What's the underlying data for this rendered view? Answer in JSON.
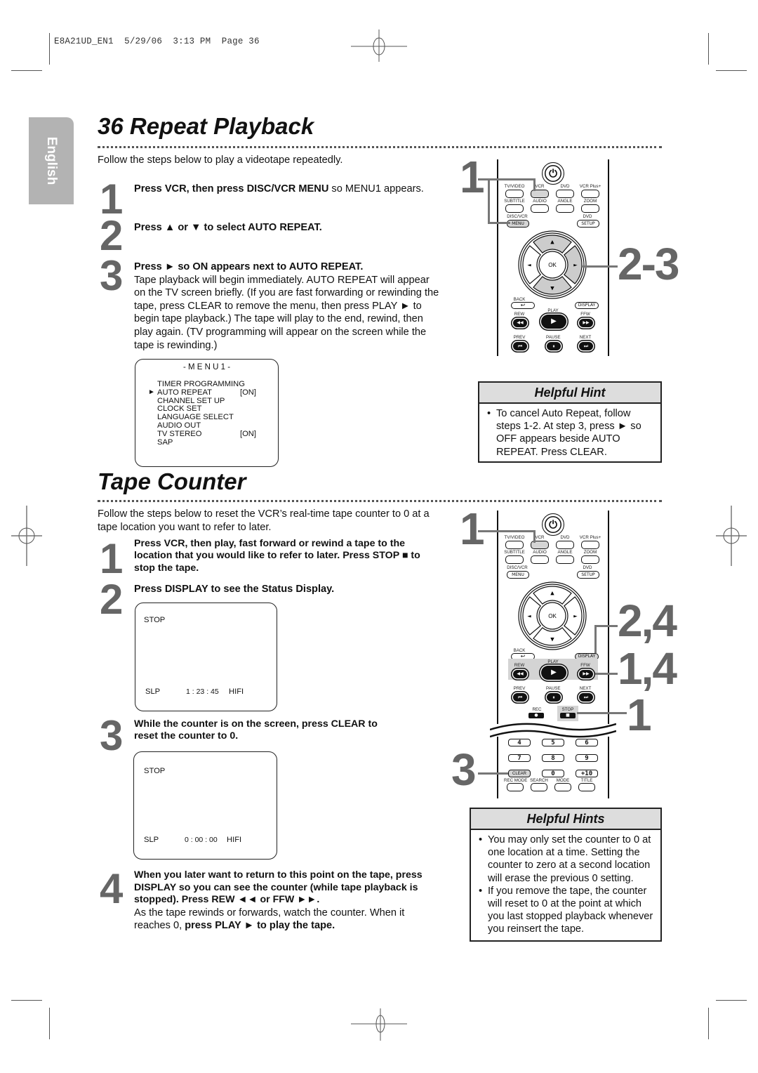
{
  "slug": "E8A21UD_EN1  5/29/06  3:13 PM  Page 36",
  "language_tab": "English",
  "repeat": {
    "title": "36  Repeat Playback",
    "intro": "Follow the steps below to play a videotape repeatedly.",
    "steps": [
      {
        "num": "1",
        "bold": "Press VCR, then press DISC/VCR MENU",
        "text": " so MENU1 appears."
      },
      {
        "num": "2",
        "bold": "Press ▲ or ▼ to select AUTO REPEAT.",
        "text": ""
      },
      {
        "num": "3",
        "bold": "Press ► so ON appears next to AUTO REPEAT.",
        "text": "Tape playback will begin immediately. AUTO REPEAT will appear on the TV screen briefly. (If you are fast forwarding or rewinding the tape, press CLEAR to remove the menu, then press PLAY ► to begin tape playback.) The tape will play to the end, rewind, then play again. (TV programming will appear on the screen while the tape is rewinding.)"
      }
    ],
    "menu": {
      "title": "- M E N U 1 -",
      "cursor": "►",
      "items": [
        {
          "label": "TIMER PROGRAMMING",
          "value": ""
        },
        {
          "label": "AUTO REPEAT",
          "value": "[ON]"
        },
        {
          "label": "CHANNEL SET UP",
          "value": ""
        },
        {
          "label": "CLOCK SET",
          "value": ""
        },
        {
          "label": "LANGUAGE SELECT",
          "value": ""
        },
        {
          "label": "AUDIO OUT",
          "value": ""
        },
        {
          "label": "TV STEREO",
          "value": "[ON]"
        },
        {
          "label": "SAP",
          "value": ""
        }
      ]
    },
    "hint": {
      "title": "Helpful Hint",
      "items": [
        "To cancel Auto Repeat, follow steps 1-2. At step 3, press ► so OFF appears beside AUTO REPEAT. Press CLEAR."
      ]
    },
    "callouts": [
      "1",
      "2-3"
    ]
  },
  "counter": {
    "title": "Tape Counter",
    "intro": "Follow the steps below to reset the VCR’s real-time tape counter to 0 at a tape location you want to refer to later.",
    "steps": [
      {
        "num": "1",
        "bold": "Press VCR, then play, fast forward or rewind a tape to the location that you would like to refer to later. Press STOP ■ to stop the tape.",
        "text": ""
      },
      {
        "num": "2",
        "bold": "Press DISPLAY to see the Status Display.",
        "text": ""
      },
      {
        "num": "3",
        "bold": "While the counter is on the screen, press CLEAR to reset the counter to 0.",
        "text": ""
      },
      {
        "num": "4",
        "bold": "When you later want to return to this point on the tape, press DISPLAY so you can see the counter (while tape playback is stopped). Press REW ◄◄ or FFW ►►.",
        "text": "As the tape rewinds or forwards, watch the counter. When it reaches 0, ",
        "bold2": "press PLAY ► to play the tape."
      }
    ],
    "screen1": {
      "status": "STOP",
      "mode": "SLP",
      "time": "1 : 23 : 45",
      "audio": "HIFI"
    },
    "screen2": {
      "status": "STOP",
      "mode": "SLP",
      "time": "0 : 00 : 00",
      "audio": "HIFI"
    },
    "hint": {
      "title": "Helpful Hints",
      "items": [
        "You may only set the counter to 0 at one location at a time. Setting the counter to zero at a second location will erase the previous 0 setting.",
        "If you remove the tape, the counter will reset to 0 at the point at which you last stopped playback whenever you reinsert the tape."
      ]
    },
    "callouts": [
      "1",
      "2,4",
      "1,4",
      "1",
      "3"
    ]
  },
  "remote": {
    "row1": [
      "TV/VIDEO",
      "VCR",
      "DVD",
      "VCR Plus+"
    ],
    "row2": [
      "SUBTITLE",
      "AUDIO",
      "ANGLE",
      "ZOOM"
    ],
    "menu_top": "DISC/VCR",
    "menu_btn": "MENU",
    "setup_top": "DVD",
    "setup_btn": "SETUP",
    "ok": "OK",
    "up": "▲",
    "down": "▼",
    "left": "◄",
    "right": "►",
    "back": "BACK",
    "back_glyph": "↩",
    "display": "DISPLAY",
    "play": "PLAY",
    "rew": "REW",
    "ffw": "FFW",
    "prev": "PREV",
    "pause": "PAUSE",
    "next": "NEXT",
    "rec": "REC",
    "stop": "STOP",
    "keys": [
      "4",
      "5",
      "6",
      "7",
      "8",
      "9",
      "CLEAR",
      "0",
      "+10"
    ],
    "bottom": [
      "REC MODE",
      "SEARCH",
      "MODE",
      "TITLE"
    ],
    "glyphs": {
      "power": "⏻",
      "play": "▶",
      "rew": "◀◀",
      "ffw": "▶▶",
      "prev": "⏮",
      "pause": "⏸",
      "next": "⏭",
      "rec": "●",
      "stop": "■"
    }
  }
}
